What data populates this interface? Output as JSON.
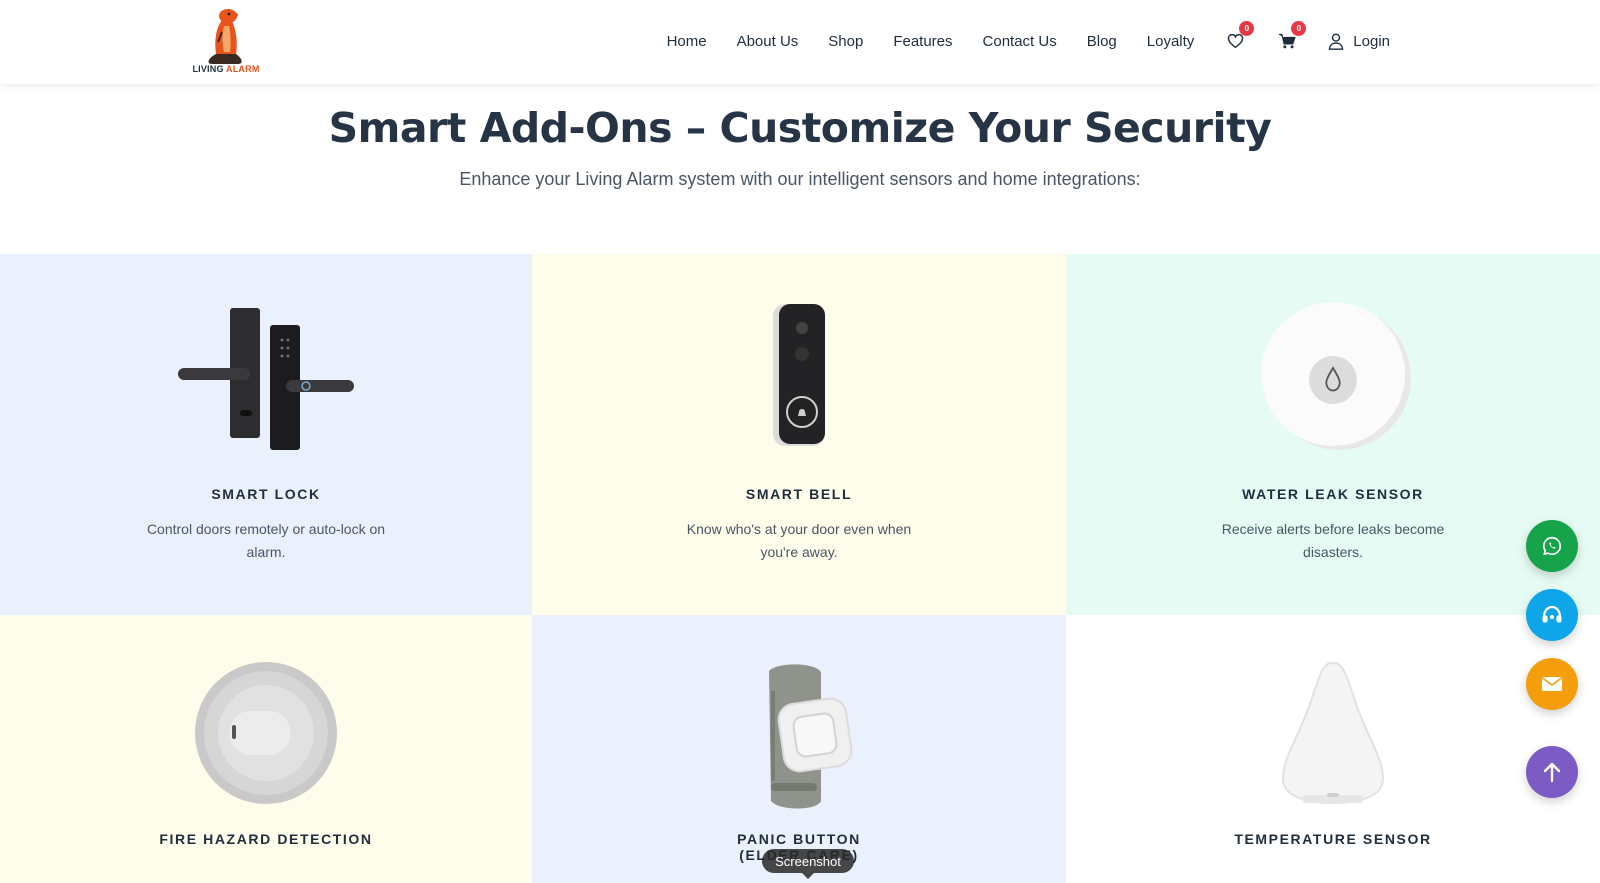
{
  "brand": {
    "text_a": "LIVING ",
    "text_b": "ALARM"
  },
  "nav": {
    "items": [
      "Home",
      "About Us",
      "Shop",
      "Features",
      "Contact Us",
      "Blog",
      "Loyalty"
    ],
    "wishlist_count": "0",
    "cart_count": "0",
    "login_label": "Login"
  },
  "hero": {
    "title": "Smart Add-Ons – Customize Your Security",
    "subtitle": "Enhance your Living Alarm system with our intelligent sensors and home integrations:"
  },
  "cards": [
    {
      "title": "SMART LOCK",
      "desc": "Control doors remotely or auto-lock on alarm.",
      "bg": "#eaf1fd"
    },
    {
      "title": "SMART BELL",
      "desc": "Know who's at your door even when you're away.",
      "bg": "#fefdeb"
    },
    {
      "title": "WATER LEAK SENSOR",
      "desc": "Receive alerts before leaks become disasters.",
      "bg": "#e6fbf3"
    },
    {
      "title": "FIRE HAZARD DETECTION",
      "desc": "",
      "bg": "#fefdeb"
    },
    {
      "title": "PANIC BUTTON",
      "title_line2": "(ELDER CARE)",
      "desc": "",
      "bg": "#eaf1fd"
    },
    {
      "title": "TEMPERATURE SENSOR",
      "desc": "",
      "bg": "#ffffff"
    }
  ],
  "tooltip": "Screenshot",
  "colors": {
    "whatsapp": "#16a34a",
    "support": "#0ea5e9",
    "email": "#f59e0b",
    "scroll_top": "#7c5cc4",
    "badge": "#e53946"
  }
}
